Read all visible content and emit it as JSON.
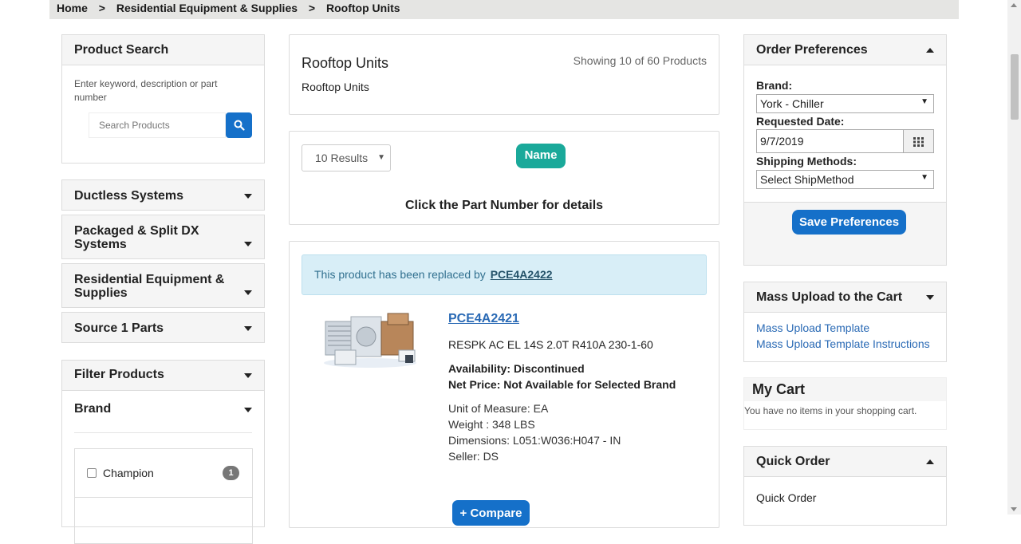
{
  "breadcrumb": [
    "Home",
    "Residential Equipment & Supplies",
    "Rooftop Units"
  ],
  "breadcrumb_separator": ">",
  "product_search": {
    "title": "Product Search",
    "hint": "Enter keyword, description or part number",
    "placeholder": "Search Products"
  },
  "categories": [
    "Ductless Systems",
    "Packaged & Split DX Systems",
    "Residential Equipment & Supplies",
    "Source 1 Parts"
  ],
  "filter": {
    "title": "Filter Products",
    "brand_title": "Brand",
    "brands": [
      {
        "name": "Champion",
        "count": "1"
      }
    ]
  },
  "category_header": {
    "title": "Rooftop Units",
    "subtitle": "Rooftop Units",
    "showing": "Showing 10 of 60 Products"
  },
  "results_bar": {
    "results_select": "10 Results",
    "sort_label": "Name",
    "instructions": "Click the Part Number for details"
  },
  "product": {
    "notice_text": "This product has been replaced by",
    "replacement_part": "PCE4A2422",
    "part_number": "PCE4A2421",
    "description": "RESPK AC EL 14S 2.0T R410A 230-1-60",
    "availability": "Availability: Discontinued",
    "net_price": "Net Price: Not Available for Selected Brand",
    "unit_of_measure": "Unit of Measure: EA",
    "weight": "Weight : 348 LBS",
    "dimensions": "Dimensions: L051:W036:H047 - IN",
    "seller": "Seller: DS",
    "compare_label": "+ Compare"
  },
  "order_prefs": {
    "title": "Order Preferences",
    "brand_label": "Brand:",
    "brand_value": "York - Chiller",
    "date_label": "Requested Date:",
    "date_value": "9/7/2019",
    "shipping_label": "Shipping Methods:",
    "shipping_value": "Select ShipMethod",
    "save_label": "Save Preferences"
  },
  "mass_upload": {
    "title": "Mass Upload to the Cart",
    "links": [
      "Mass Upload Template",
      "Mass Upload Template Instructions"
    ]
  },
  "cart": {
    "title": "My Cart",
    "empty_text": "You have no items in your shopping cart."
  },
  "quick_order": {
    "title": "Quick Order",
    "label": "Quick Order"
  },
  "colors": {
    "accent_blue": "#1570c9",
    "teal_badge": "#1aa99a",
    "notice_bg": "#d8eef7",
    "link_blue": "#2a6ab5"
  },
  "icons": [
    "search-icon",
    "calendar-icon",
    "caret-down-icon",
    "caret-up-icon",
    "select-arrow-icon"
  ]
}
